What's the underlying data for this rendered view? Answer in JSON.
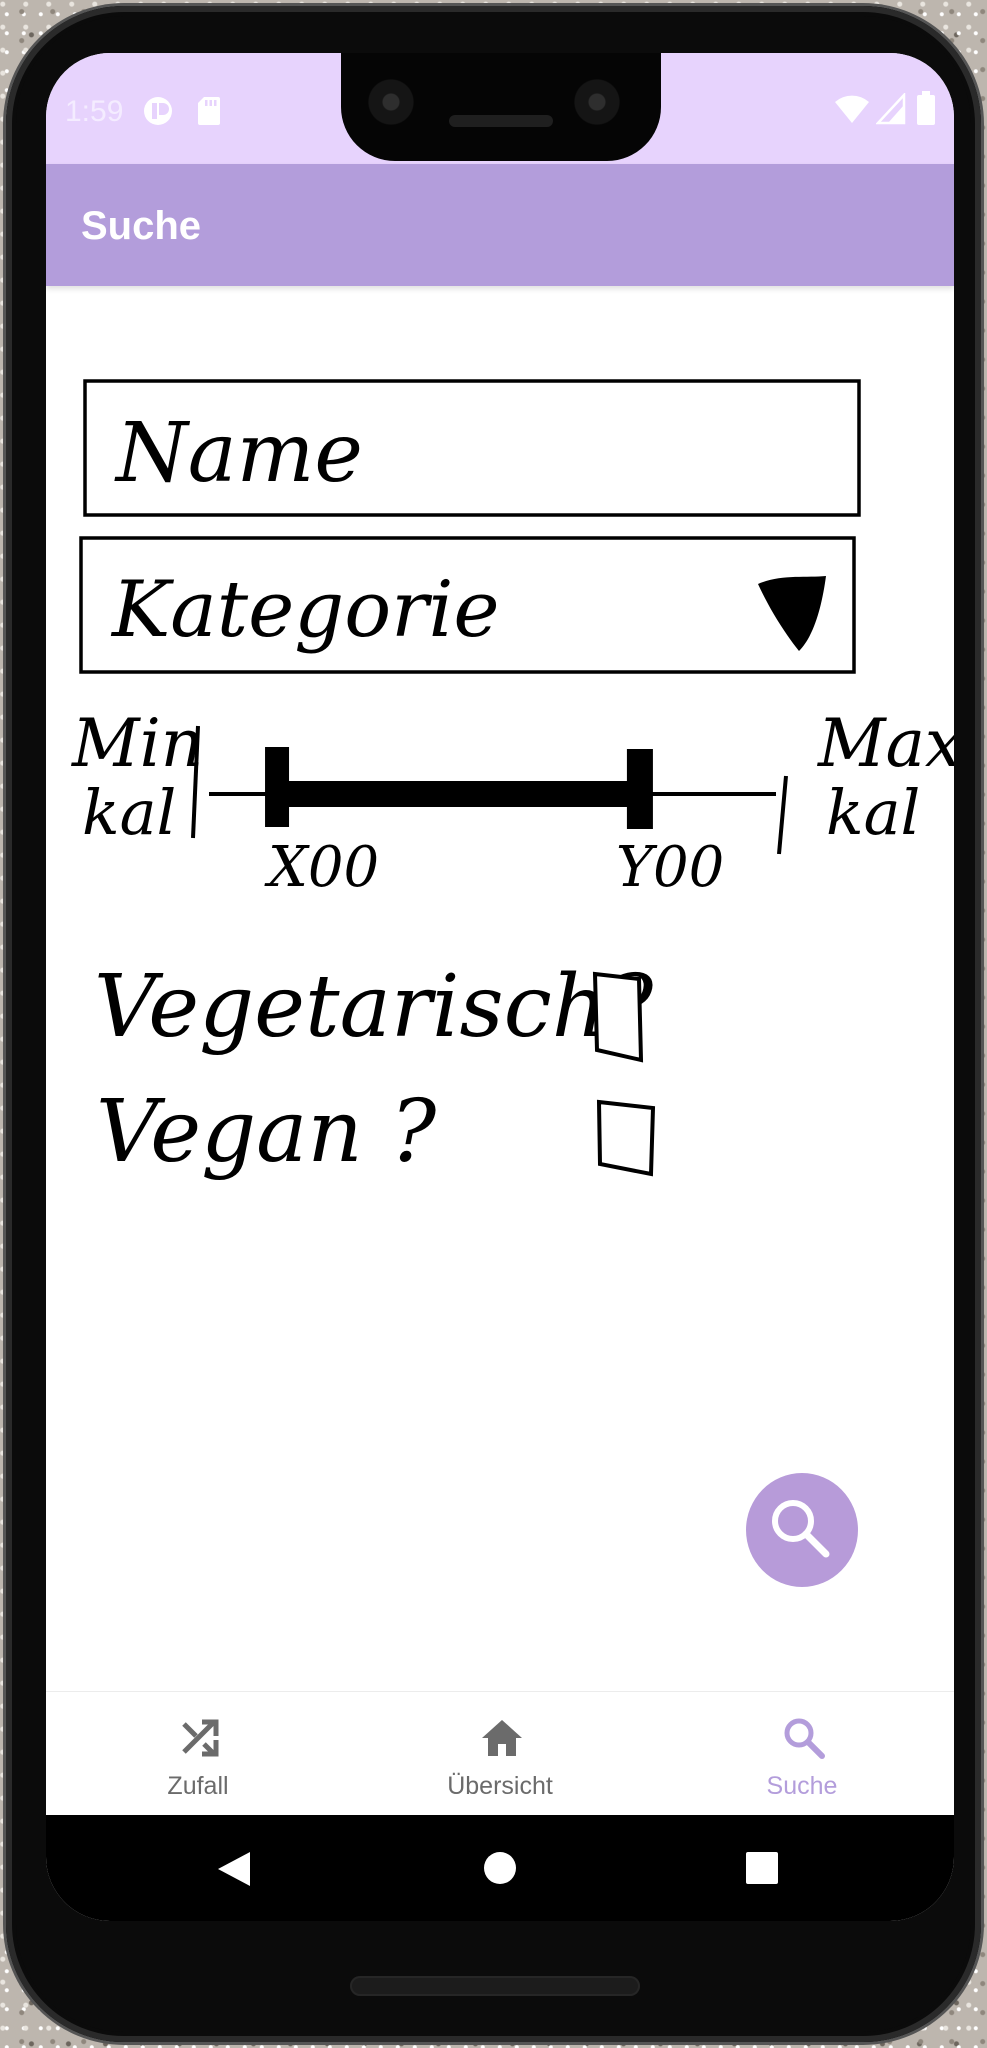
{
  "status_bar": {
    "time": "1:59"
  },
  "app_bar": {
    "title": "Suche"
  },
  "form": {
    "name_label": "Name",
    "category_label": "Kategorie",
    "min_label_line1": "Min",
    "min_label_line2": "kal",
    "max_label_line1": "Max",
    "max_label_line2": "kal",
    "range_low_value": "X00",
    "range_high_value": "Y00",
    "vegetarian_label": "Vegetarisch?",
    "vegan_label": "Vegan ?",
    "range_low_fraction": 0.12,
    "range_high_fraction": 0.76
  },
  "bottom_nav": {
    "items": [
      {
        "label": "Zufall",
        "icon": "shuffle-icon",
        "active": false
      },
      {
        "label": "Übersicht",
        "icon": "home-icon",
        "active": false
      },
      {
        "label": "Suche",
        "icon": "search-icon",
        "active": true
      }
    ]
  },
  "colors": {
    "status_bar": "#e7d3fd",
    "app_bar": "#b39ddb",
    "accent": "#b39ddb",
    "fab": "#b79bd9"
  }
}
